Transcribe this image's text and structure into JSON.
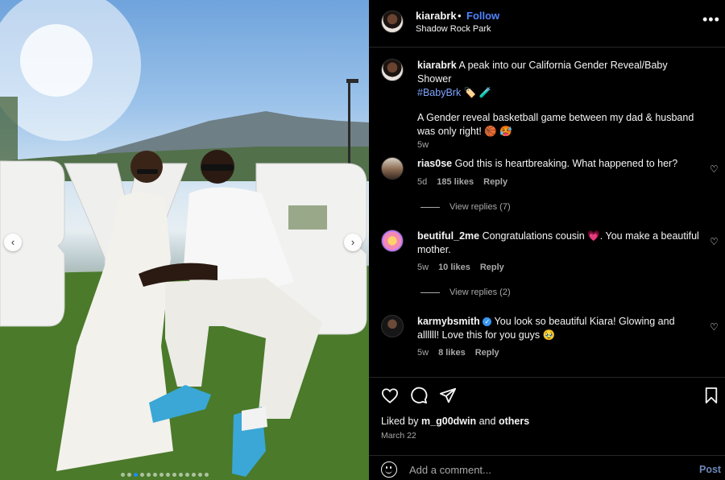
{
  "post": {
    "username": "kiarabrk",
    "separator": "•",
    "follow_label": "Follow",
    "location": "Shadow Rock Park",
    "more_icon": "more-horizontal-icon",
    "more_label": "•••"
  },
  "photo": {
    "prev_label": "‹",
    "next_label": "›",
    "carousel_dots": 14,
    "active_dot": 2
  },
  "caption": {
    "username": "kiarabrk",
    "text": "A peak into our California Gender Reveal/Baby Shower",
    "hashtag": "#BabyBrk",
    "emoji_line1": "🏷️ 🧪",
    "text2": "A Gender reveal basketball game between my dad & husband was only right! 🏀 🥵",
    "age": "5w"
  },
  "comments": [
    {
      "username": "rias0se",
      "text": "God this is heartbreaking. What happened to her?",
      "age": "5d",
      "likes": "185 likes",
      "reply_label": "Reply",
      "view_replies": "View replies (7)"
    },
    {
      "username": "beutiful_2me",
      "text": "Congratulations cousin 💗. You make a beautiful mother.",
      "age": "5w",
      "likes": "10 likes",
      "reply_label": "Reply",
      "view_replies": "View replies (2)"
    },
    {
      "username": "karmybsmith",
      "verified": true,
      "text": "You look so beautiful Kiara! Glowing and allllll! Love this for you guys 🥹",
      "age": "5w",
      "likes": "8 likes",
      "reply_label": "Reply"
    }
  ],
  "footer": {
    "liked_prefix": "Liked by",
    "liked_user": "m_g00dwin",
    "liked_and": "and",
    "liked_others": "others",
    "date": "March 22",
    "comment_placeholder": "Add a comment...",
    "post_label": "Post"
  },
  "colors": {
    "accent": "#4f83ff",
    "hashtag": "#7ea4ff",
    "muted": "#a8a8a8",
    "background": "#000000",
    "heart_pink": "#e83e8c"
  }
}
